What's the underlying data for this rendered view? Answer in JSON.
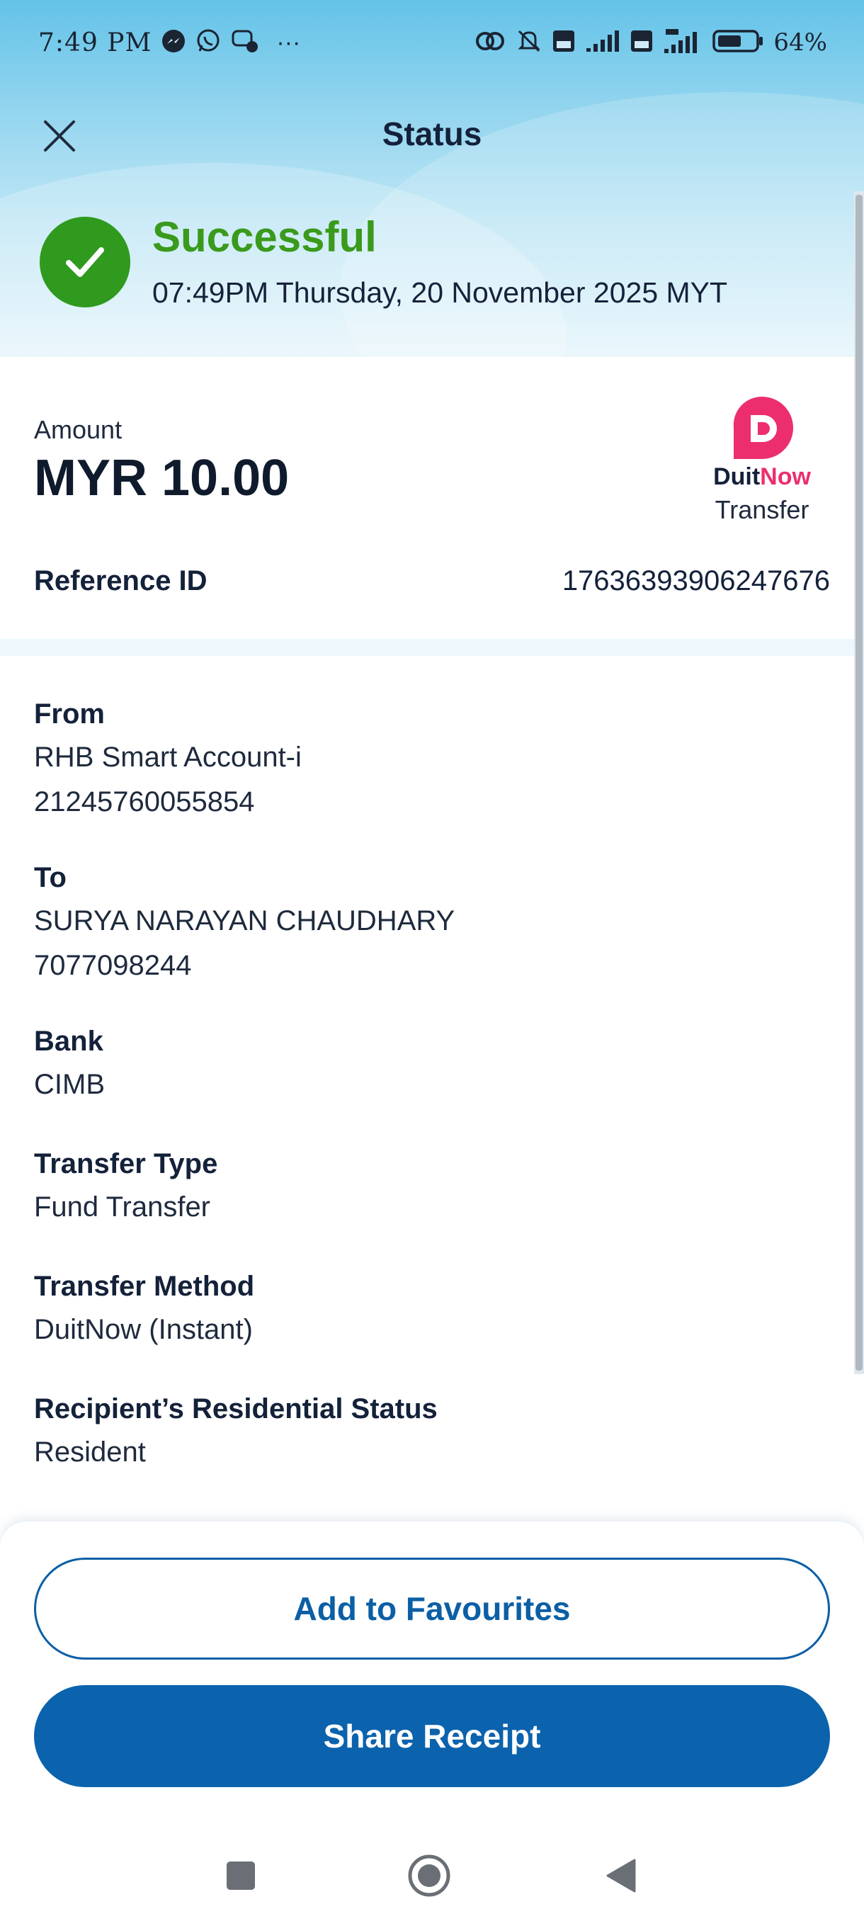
{
  "status_bar": {
    "time": "7:49 PM",
    "more": "···",
    "battery_percent": "64%",
    "battery_level": 0.64
  },
  "header": {
    "title": "Status",
    "close_icon": "close-icon"
  },
  "result": {
    "status": "Successful",
    "timestamp": "07:49PM Thursday, 20 November 2025 MYT",
    "icon": "check-icon",
    "color": "#2f9a1e"
  },
  "amount": {
    "label": "Amount",
    "value": "MYR 10.00"
  },
  "payment_brand": {
    "name_part1": "Duit",
    "name_part2": "Now",
    "subtitle": "Transfer",
    "brand_color": "#ec2e6f"
  },
  "reference": {
    "label": "Reference ID",
    "value": "17636393906247676"
  },
  "details": [
    {
      "label": "From",
      "lines": [
        "RHB Smart Account-i",
        "21245760055854"
      ]
    },
    {
      "label": "To",
      "lines": [
        "SURYA NARAYAN CHAUDHARY",
        "7077098244"
      ]
    },
    {
      "label": "Bank",
      "lines": [
        "CIMB"
      ]
    },
    {
      "label": "Transfer Type",
      "lines": [
        "Fund Transfer"
      ]
    },
    {
      "label": "Transfer Method",
      "lines": [
        "DuitNow (Instant)"
      ]
    },
    {
      "label": "Recipient’s Residential Status",
      "lines": [
        "Resident"
      ]
    }
  ],
  "actions": {
    "add_favourites": "Add to Favourites",
    "share_receipt": "Share Receipt",
    "primary_color": "#0b62ad"
  },
  "nav": {
    "recents_icon": "recents-square-icon",
    "home_icon": "home-circle-icon",
    "back_icon": "back-triangle-icon"
  }
}
